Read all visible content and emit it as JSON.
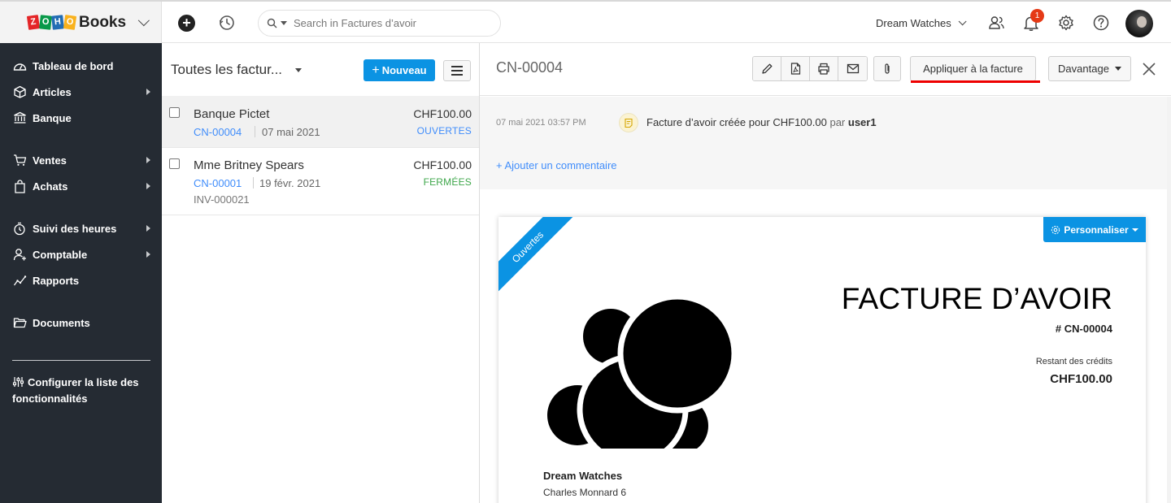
{
  "brand": {
    "name": "Books",
    "zoho_letters": [
      "Z",
      "O",
      "H",
      "O"
    ]
  },
  "topbar": {
    "search_placeholder": "Search in Factures d’avoir",
    "organization": "Dream Watches",
    "notification_count": "1"
  },
  "sidebar": {
    "items": [
      {
        "label": "Tableau de bord",
        "icon": "dashboard-icon",
        "has_arrow": false
      },
      {
        "label": "Articles",
        "icon": "items-icon",
        "has_arrow": true
      },
      {
        "label": "Banque",
        "icon": "bank-icon",
        "has_arrow": false
      },
      {
        "label": "Ventes",
        "icon": "cart-icon",
        "has_arrow": true
      },
      {
        "label": "Achats",
        "icon": "bag-icon",
        "has_arrow": true
      },
      {
        "label": "Suivi des heures",
        "icon": "timer-icon",
        "has_arrow": true
      },
      {
        "label": "Comptable",
        "icon": "accountant-icon",
        "has_arrow": true
      },
      {
        "label": "Rapports",
        "icon": "reports-icon",
        "has_arrow": false
      },
      {
        "label": "Documents",
        "icon": "folder-icon",
        "has_arrow": false
      }
    ],
    "config_label": "Configurer la liste des fonctionnalités"
  },
  "list": {
    "title": "Toutes les factur...",
    "new_button": "Nouveau",
    "rows": [
      {
        "name": "Banque Pictet",
        "amount": "CHF100.00",
        "number": "CN-00004",
        "date": "07 mai 2021",
        "status": "OUVERTES",
        "status_color": "#408dfb",
        "invoice": ""
      },
      {
        "name": "Mme Britney Spears",
        "amount": "CHF100.00",
        "number": "CN-00001",
        "date": "19 févr. 2021",
        "status": "FERMÉES",
        "status_color": "#3fa74b",
        "invoice": "INV-000021"
      }
    ]
  },
  "detail": {
    "title": "CN-00004",
    "apply_button": "Appliquer à la facture",
    "more_button": "Davantage",
    "activity": {
      "time": "07 mai 2021 03:57 PM",
      "text": "Facture d’avoir créée pour CHF100.00",
      "by": "par",
      "user": "user1"
    },
    "add_comment": "+ Ajouter un commentaire"
  },
  "document": {
    "ribbon": "Ouvertes",
    "customize_button": "Personnaliser",
    "title": "FACTURE D’AVOIR",
    "number": "# CN-00004",
    "balance_label": "Restant des crédits",
    "balance": "CHF100.00",
    "org_name": "Dream Watches",
    "org_address": "Charles Monnard 6"
  },
  "colors": {
    "accent": "#0b93e3",
    "sidebar": "#252b33",
    "link": "#408dfb",
    "highlight": "#e00000"
  }
}
